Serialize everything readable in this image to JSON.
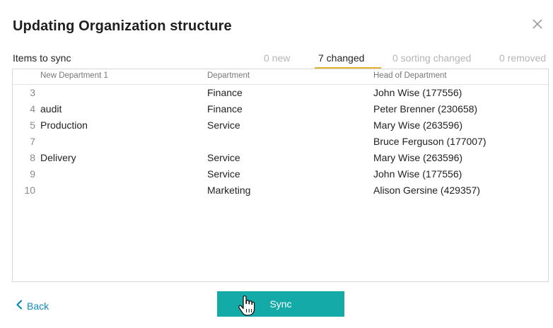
{
  "dialog": {
    "title": "Updating Organization structure",
    "close_icon": "close-icon"
  },
  "toolbar": {
    "items_label": "Items to sync",
    "tabs": [
      {
        "label": "0 new",
        "active": false
      },
      {
        "label": "7 changed",
        "active": true
      },
      {
        "label": "0 sorting changed",
        "active": false
      },
      {
        "label": "0 removed",
        "active": false
      }
    ],
    "accent_color": "#e7b32d"
  },
  "table": {
    "columns": [
      "New Department 1",
      "Department",
      "Head of Department"
    ],
    "rows": [
      {
        "num": "3",
        "new_department": "",
        "department": "Finance",
        "head": "John Wise (177556)"
      },
      {
        "num": "4",
        "new_department": "audit",
        "department": "Finance",
        "head": "Peter Brenner (230658)"
      },
      {
        "num": "5",
        "new_department": "Production",
        "department": "Service",
        "head": "Mary Wise (263596)"
      },
      {
        "num": "7",
        "new_department": "",
        "department": "",
        "head": "Bruce Ferguson (177007)"
      },
      {
        "num": "8",
        "new_department": "Delivery",
        "department": "Service",
        "head": "Mary Wise (263596)"
      },
      {
        "num": "9",
        "new_department": "",
        "department": "Service",
        "head": "John Wise (177556)"
      },
      {
        "num": "10",
        "new_department": "",
        "department": "Marketing",
        "head": "Alison Gersine (429357)"
      }
    ]
  },
  "footer": {
    "back_label": "Back",
    "sync_label": "Sync",
    "sync_color": "#14aaa8",
    "link_color": "#0f8bbb"
  }
}
